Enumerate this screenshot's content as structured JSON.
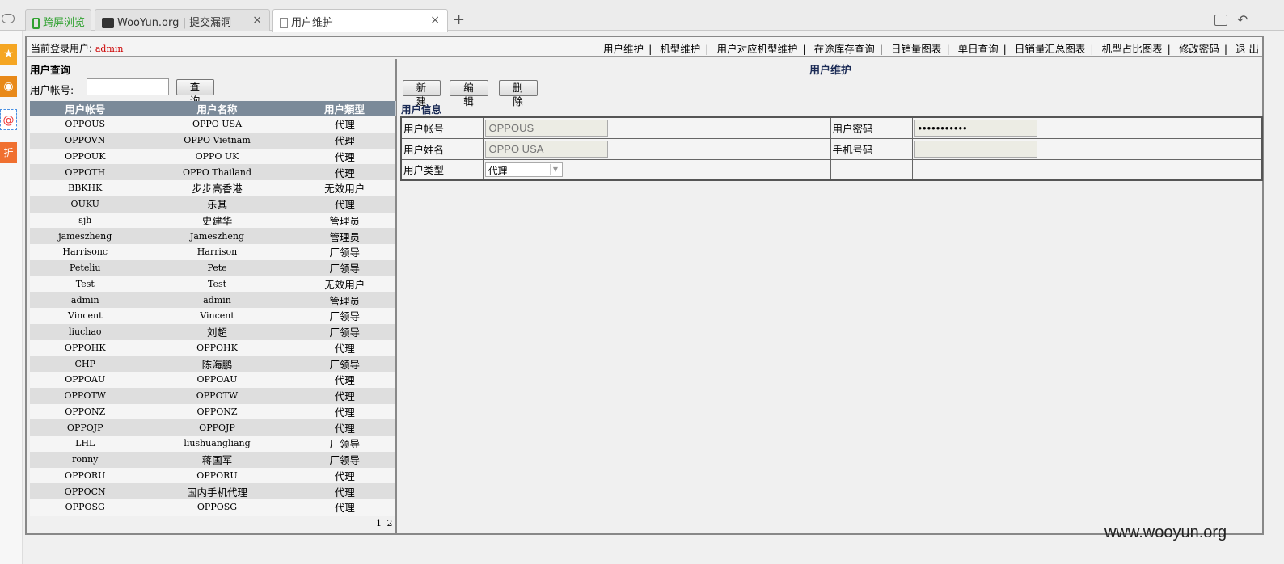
{
  "browser": {
    "tabs": [
      {
        "label": "跨屏浏览",
        "icon": "phone-icon"
      },
      {
        "label": "WooYun.org | 提交漏洞",
        "icon": "wooyun-logo-icon",
        "close": "×"
      },
      {
        "label": "用户维护",
        "icon": "page-icon",
        "close": "×"
      }
    ],
    "new_tab": "+"
  },
  "topbar": {
    "login_label": "当前登录用户:",
    "login_user": "admin",
    "nav": [
      "用户维护",
      "机型维护",
      "用户对应机型维护",
      "在途库存查询",
      "日销量图表",
      "单日查询",
      "日销量汇总图表",
      "机型占比图表",
      "修改密码",
      "退 出"
    ],
    "separator": "|"
  },
  "left": {
    "title": "用户查询",
    "account_label": "用户帐号:",
    "account_value": "",
    "query_button": "查 询",
    "columns": [
      "用户帐号",
      "用户名称",
      "用户類型"
    ],
    "rows": [
      [
        "OPPOUS",
        "OPPO USA",
        "代理"
      ],
      [
        "OPPOVN",
        "OPPO Vietnam",
        "代理"
      ],
      [
        "OPPOUK",
        "OPPO UK",
        "代理"
      ],
      [
        "OPPOTH",
        "OPPO Thailand",
        "代理"
      ],
      [
        "BBKHK",
        "步步高香港",
        "无效用户"
      ],
      [
        "OUKU",
        "乐其",
        "代理"
      ],
      [
        "sjh",
        "史建华",
        "管理员"
      ],
      [
        "jameszheng",
        "Jameszheng",
        "管理员"
      ],
      [
        "Harrisonc",
        "Harrison",
        "厂领导"
      ],
      [
        "Peteliu",
        "Pete",
        "厂领导"
      ],
      [
        "Test",
        "Test",
        "无效用户"
      ],
      [
        "admin",
        "admin",
        "管理员"
      ],
      [
        "Vincent",
        "Vincent",
        "厂领导"
      ],
      [
        "liuchao",
        "刘超",
        "厂领导"
      ],
      [
        "OPPOHK",
        "OPPOHK",
        "代理"
      ],
      [
        "CHP",
        "陈海鹏",
        "厂领导"
      ],
      [
        "OPPOAU",
        "OPPOAU",
        "代理"
      ],
      [
        "OPPOTW",
        "OPPOTW",
        "代理"
      ],
      [
        "OPPONZ",
        "OPPONZ",
        "代理"
      ],
      [
        "OPPOJP",
        "OPPOJP",
        "代理"
      ],
      [
        "LHL",
        "liushuangliang",
        "厂领导"
      ],
      [
        "ronny",
        "蒋国军",
        "厂领导"
      ],
      [
        "OPPORU",
        "OPPORU",
        "代理"
      ],
      [
        "OPPOCN",
        "国内手机代理",
        "代理"
      ],
      [
        "OPPOSG",
        "OPPOSG",
        "代理"
      ]
    ],
    "pager": "1 2"
  },
  "right": {
    "title": "用户维护",
    "new_button": "新 建",
    "edit_button": "编 辑",
    "delete_button": "删 除",
    "section_title": "用户信息",
    "fields": {
      "account_label": "用户帐号",
      "account_value": "OPPOUS",
      "password_label": "用户密码",
      "password_value": "•••••••••••",
      "name_label": "用户姓名",
      "name_value": "OPPO USA",
      "phone_label": "手机号码",
      "phone_value": "",
      "type_label": "用户类型",
      "type_value": "代理"
    }
  },
  "watermark": "www.wooyun.org"
}
